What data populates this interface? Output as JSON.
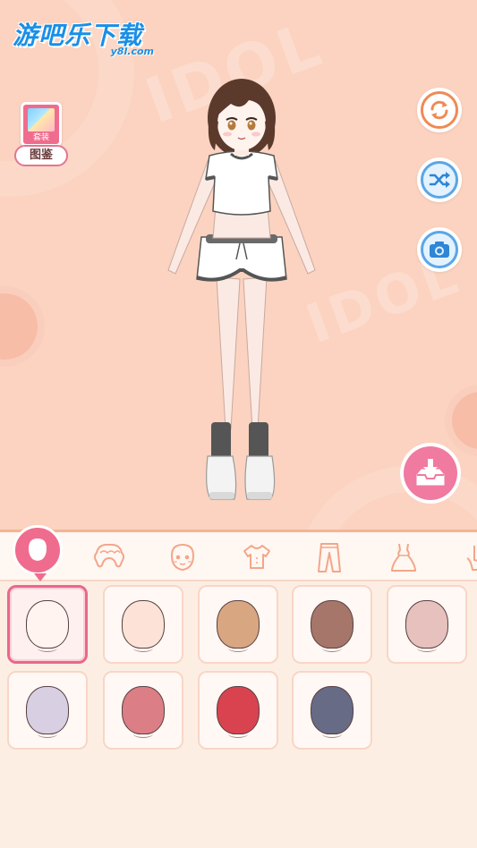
{
  "watermark": {
    "main": "游吧乐下载",
    "sub": "y8l.com"
  },
  "background_text": [
    "IDOL",
    "IDOL"
  ],
  "gallery": {
    "icon": "gallery-book-icon",
    "subtitle": "套装",
    "label": "图鉴"
  },
  "actions": [
    {
      "name": "reset-button",
      "icon": "refresh-icon",
      "color": "#f08a55"
    },
    {
      "name": "random-button",
      "icon": "shuffle-icon",
      "color": "#5aa6e8"
    },
    {
      "name": "camera-button",
      "icon": "camera-icon",
      "color": "#5aa6e8"
    },
    {
      "name": "save-button",
      "icon": "download-tray-icon",
      "color": "#f07aa0"
    }
  ],
  "tabs": [
    {
      "name": "tab-face-shape",
      "icon": "face-shape-icon",
      "active": true
    },
    {
      "name": "tab-hair",
      "icon": "hair-icon",
      "active": false
    },
    {
      "name": "tab-face",
      "icon": "face-icon",
      "active": false
    },
    {
      "name": "tab-top",
      "icon": "shirt-icon",
      "active": false
    },
    {
      "name": "tab-pants",
      "icon": "pants-icon",
      "active": false
    },
    {
      "name": "tab-dress",
      "icon": "dress-icon",
      "active": false
    },
    {
      "name": "tab-shoes",
      "icon": "shoe-icon",
      "active": false
    }
  ],
  "skin_tones": [
    {
      "color": "#fff4ef",
      "selected": true
    },
    {
      "color": "#fde3d7",
      "selected": false
    },
    {
      "color": "#d9a682",
      "selected": false
    },
    {
      "color": "#a6766a",
      "selected": false
    },
    {
      "color": "#e7c1be",
      "selected": false
    },
    {
      "color": "#d8cfe3",
      "selected": false
    },
    {
      "color": "#dc7e85",
      "selected": false
    },
    {
      "color": "#d9434f",
      "selected": false
    },
    {
      "color": "#676b86",
      "selected": false
    }
  ],
  "colors": {
    "stage_bg": "#fbd3c0",
    "panel_bg": "#fdeee4",
    "accent_pink": "#f06c8e",
    "tab_outline": "#f3b19a"
  }
}
